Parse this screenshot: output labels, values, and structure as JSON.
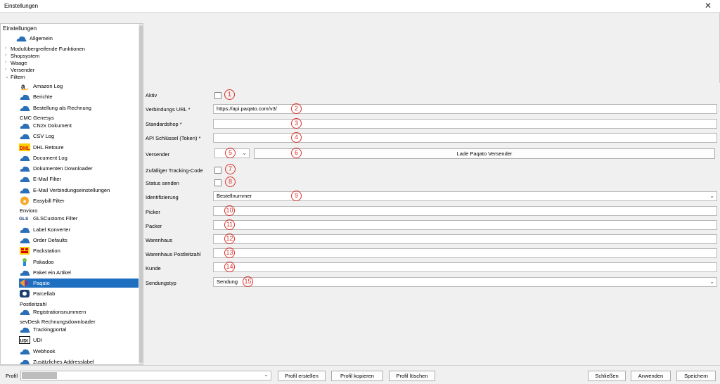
{
  "window": {
    "title": "Einstellungen",
    "close": "✕"
  },
  "tree": {
    "root": "Einstellungen",
    "top_item": "Allgemein",
    "groups": [
      {
        "label": "Modulübergreifende Funktionen",
        "expander": "›"
      },
      {
        "label": "Shopsystem",
        "expander": "›"
      },
      {
        "label": "Waage",
        "expander": "›"
      },
      {
        "label": "Versender",
        "expander": "›"
      },
      {
        "label": "Filtern",
        "expander": "⌄"
      }
    ],
    "items": [
      {
        "label": "Amazon Log",
        "icon": "amazon-icon",
        "section": false
      },
      {
        "label": "Berichte",
        "icon": "cloud-icon",
        "section": false
      },
      {
        "label": "Bestellung als Rechnung",
        "icon": "cloud-icon",
        "section": false
      },
      {
        "label": "CMC Genesys",
        "icon": "",
        "section": true
      },
      {
        "label": "CN2x Dokument",
        "icon": "cloud-icon",
        "section": false
      },
      {
        "label": "CSV Log",
        "icon": "cloud-icon",
        "section": false
      },
      {
        "label": "DHL Retoure",
        "icon": "dhl-icon",
        "section": false
      },
      {
        "label": "Document Log",
        "icon": "cloud-icon",
        "section": false
      },
      {
        "label": "Dokumenten Downloader",
        "icon": "cloud-icon",
        "section": false
      },
      {
        "label": "E-Mail Filter",
        "icon": "cloud-icon",
        "section": false
      },
      {
        "label": "E-Mail Verbindungseinstellungen",
        "icon": "cloud-icon",
        "section": false
      },
      {
        "label": "Easybill Filter",
        "icon": "easybill-icon",
        "section": false
      },
      {
        "label": "Envioro",
        "icon": "",
        "section": true
      },
      {
        "label": "GLSCustoms Filter",
        "icon": "gls-icon",
        "section": false
      },
      {
        "label": "Label Konverter",
        "icon": "cloud-icon",
        "section": false
      },
      {
        "label": "Order Defaults",
        "icon": "cloud-icon",
        "section": false
      },
      {
        "label": "Packstation",
        "icon": "packstation-icon",
        "section": false
      },
      {
        "label": "Pakadoo",
        "icon": "pakadoo-icon",
        "section": false
      },
      {
        "label": "Paket ein Artikel",
        "icon": "cloud-icon",
        "section": false
      },
      {
        "label": "Paqato",
        "icon": "paqato-icon",
        "section": false,
        "selected": true
      },
      {
        "label": "Parcellab",
        "icon": "parcellab-icon",
        "section": false
      },
      {
        "label": "Postleitzahl",
        "icon": "",
        "section": true
      },
      {
        "label": "Registrationsnummern",
        "icon": "cloud-icon",
        "section": false
      },
      {
        "label": "sevDesk Rechnungsdownloader",
        "icon": "",
        "section": true
      },
      {
        "label": "Trackingportal",
        "icon": "cloud-icon",
        "section": false
      },
      {
        "label": "UDI",
        "icon": "udi-icon",
        "section": false
      },
      {
        "label": "Webhook",
        "icon": "cloud-icon",
        "section": false
      },
      {
        "label": "Zusätzliches Addresslabel",
        "icon": "cloud-icon",
        "section": false
      }
    ]
  },
  "form": {
    "aktiv": {
      "label": "Aktiv",
      "num": "1"
    },
    "verbindungs_url": {
      "label": "Verbindungs URL *",
      "value": "https://api.paqato.com/v3/",
      "num": "2"
    },
    "standardshop": {
      "label": "Standardshop *",
      "value": "",
      "num": "3"
    },
    "api_key": {
      "label": "API Schlüssel (Token) *",
      "value": "",
      "num": "4"
    },
    "versender": {
      "label": "Versender",
      "value": "",
      "num": "5",
      "button_label": "Lade Paqato Versender",
      "button_num": "6"
    },
    "tracking": {
      "label": "Zufälliger Tracking-Code",
      "num": "7"
    },
    "status": {
      "label": "Status senden",
      "num": "8"
    },
    "identifizierung": {
      "label": "Identifizierung",
      "value": "Bestellnummer",
      "num": "9"
    },
    "picker": {
      "label": "Picker",
      "value": "",
      "num": "10"
    },
    "packer": {
      "label": "Packer",
      "value": "",
      "num": "11"
    },
    "warenhaus": {
      "label": "Warenhaus",
      "value": "",
      "num": "12"
    },
    "warenhaus_plz": {
      "label": "Warenhaus Postleitzahl",
      "value": "",
      "num": "13"
    },
    "kunde": {
      "label": "Kunde",
      "value": "",
      "num": "14"
    },
    "sendungstyp": {
      "label": "Sendungstyp",
      "value": "Sendung",
      "num": "15"
    }
  },
  "bottom": {
    "profil_label": "Profil",
    "buttons": {
      "erstellen": "Profil erstellen",
      "kopieren": "Profil kopieren",
      "loeschen": "Profil löschen",
      "schliessen": "Schließen",
      "anwenden": "Anwenden",
      "speichern": "Speichern"
    }
  },
  "colors": {
    "selection": "#1f6fc1",
    "marker": "#d9302a"
  }
}
